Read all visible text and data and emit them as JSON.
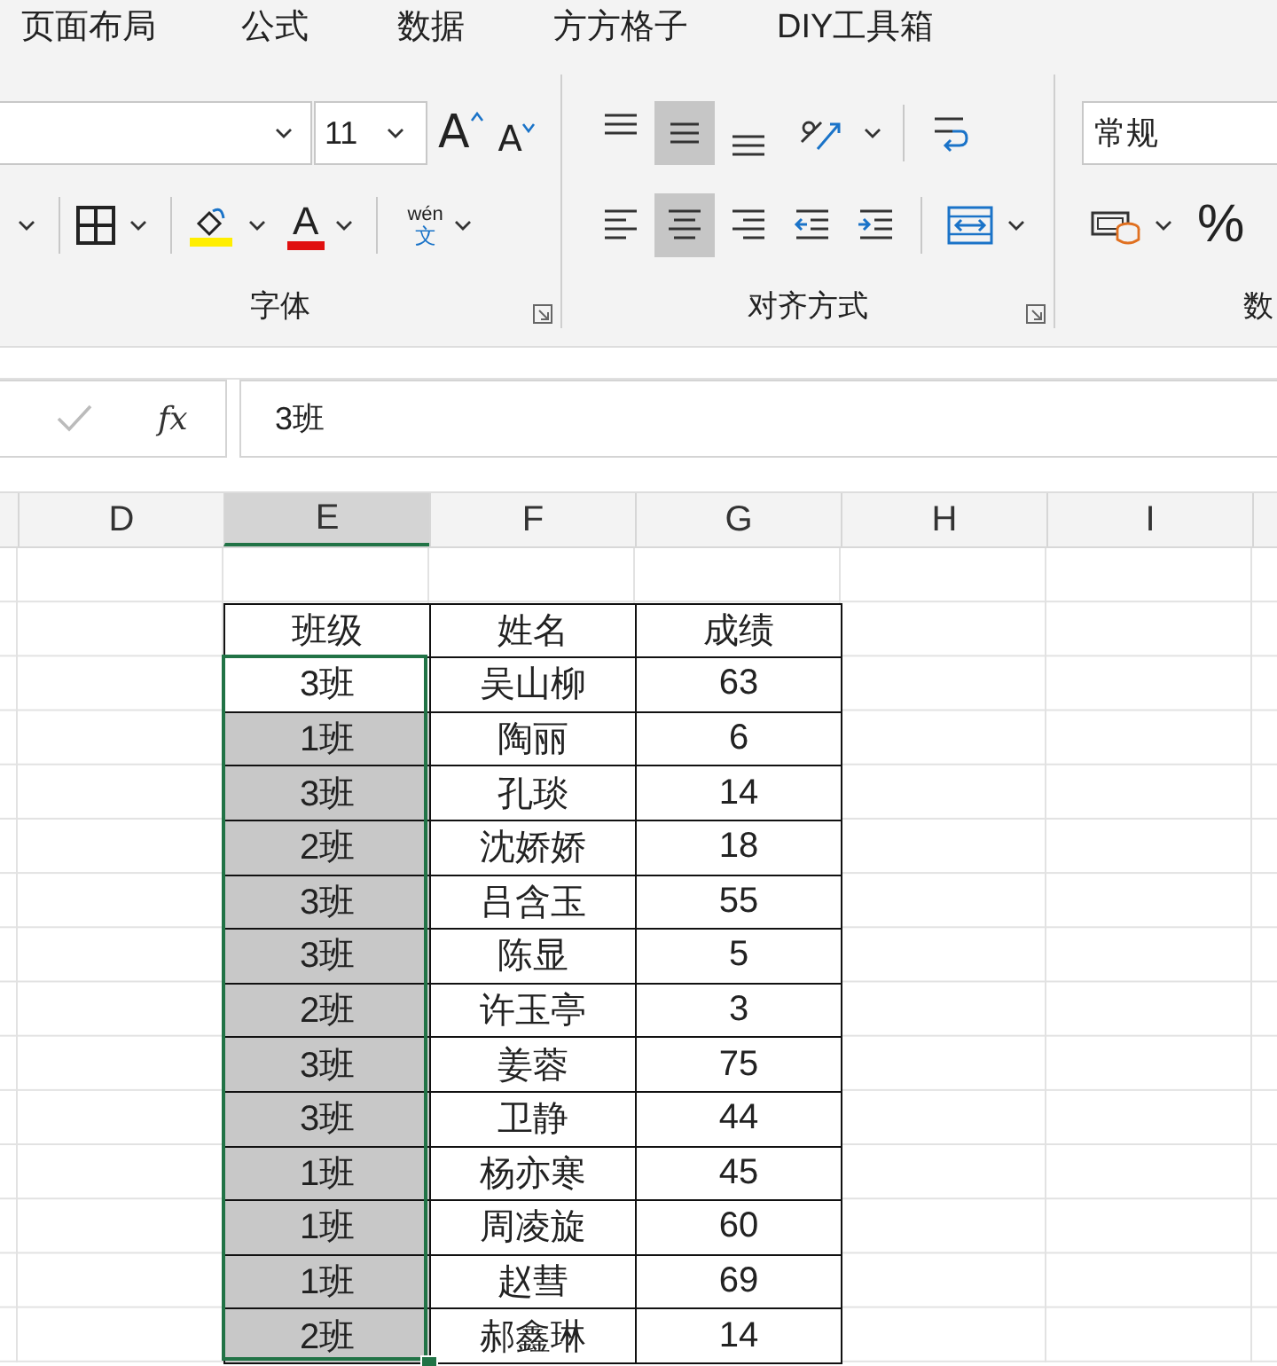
{
  "menu_tabs": [
    "页面布局",
    "公式",
    "数据",
    "方方格子",
    "DIY工具箱"
  ],
  "ribbon": {
    "font": {
      "font_size": "11",
      "grow_label": "A",
      "shrink_label": "A",
      "font_color_label": "A",
      "phonetic_label": "wén",
      "phonetic_char": "文",
      "title": "字体"
    },
    "alignment": {
      "vertical": [
        {
          "kind": "top",
          "selected": false
        },
        {
          "kind": "middle",
          "selected": true
        },
        {
          "kind": "bottom",
          "selected": false
        }
      ],
      "horizontal": [
        {
          "kind": "left",
          "selected": false
        },
        {
          "kind": "center",
          "selected": true
        },
        {
          "kind": "right",
          "selected": false
        },
        {
          "kind": "outdent",
          "selected": false
        },
        {
          "kind": "indent",
          "selected": false
        }
      ],
      "title": "对齐方式"
    },
    "number": {
      "format": "常规",
      "percent": "%",
      "title": "数"
    }
  },
  "formula_bar": {
    "function_label": "fx",
    "value": "3班"
  },
  "columns": [
    {
      "label": "D",
      "selected": false
    },
    {
      "label": "E",
      "selected": true
    },
    {
      "label": "F",
      "selected": false
    },
    {
      "label": "G",
      "selected": false
    },
    {
      "label": "H",
      "selected": false
    },
    {
      "label": "I",
      "selected": false
    }
  ],
  "table": {
    "headers": [
      "班级",
      "姓名",
      "成绩"
    ],
    "rows": [
      {
        "class": "3班",
        "name": "吴山柳",
        "score": "63",
        "selected": true,
        "active": true
      },
      {
        "class": "1班",
        "name": "陶丽",
        "score": "6",
        "selected": true,
        "active": false
      },
      {
        "class": "3班",
        "name": "孔琰",
        "score": "14",
        "selected": true,
        "active": false
      },
      {
        "class": "2班",
        "name": "沈娇娇",
        "score": "18",
        "selected": true,
        "active": false
      },
      {
        "class": "3班",
        "name": "吕含玉",
        "score": "55",
        "selected": true,
        "active": false
      },
      {
        "class": "3班",
        "name": "陈显",
        "score": "5",
        "selected": true,
        "active": false
      },
      {
        "class": "2班",
        "name": "许玉亭",
        "score": "3",
        "selected": true,
        "active": false
      },
      {
        "class": "3班",
        "name": "姜蓉",
        "score": "75",
        "selected": true,
        "active": false
      },
      {
        "class": "3班",
        "name": "卫静",
        "score": "44",
        "selected": true,
        "active": false
      },
      {
        "class": "1班",
        "name": "杨亦寒",
        "score": "45",
        "selected": true,
        "active": false
      },
      {
        "class": "1班",
        "name": "周凌旋",
        "score": "60",
        "selected": true,
        "active": false
      },
      {
        "class": "1班",
        "name": "赵彗",
        "score": "69",
        "selected": true,
        "active": false
      },
      {
        "class": "2班",
        "name": "郝鑫琳",
        "score": "14",
        "selected": true,
        "active": false
      }
    ]
  }
}
